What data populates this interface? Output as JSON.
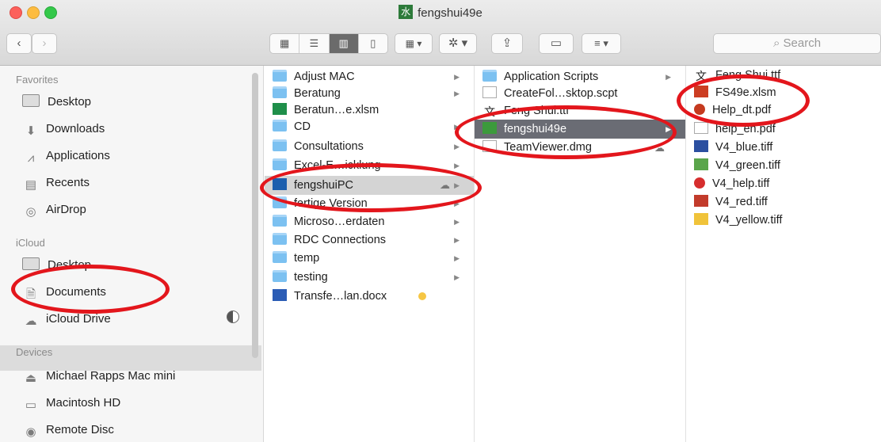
{
  "window": {
    "title": "fengshui49e"
  },
  "toolbar": {
    "back_label": "‹",
    "forward_label": "›",
    "search_placeholder": "Search"
  },
  "sidebar": {
    "favorites_header": "Favorites",
    "favorites": [
      "Desktop",
      "Downloads",
      "Applications",
      "Recents",
      "AirDrop"
    ],
    "icloud_header": "iCloud",
    "icloud": [
      "Desktop",
      "Documents",
      "iCloud Drive"
    ],
    "devices_header": "Devices",
    "devices": [
      "Michael Rapps Mac mini",
      "Macintosh HD",
      "Remote Disc"
    ]
  },
  "column1": [
    "Adjust MAC",
    "Beratung",
    "Beratun…e.xlsm",
    "CD",
    "Consultations",
    "Excel-E…icklung",
    "fengshuiPC",
    "fertige Version",
    "Microso…erdaten",
    "RDC Connections",
    "temp",
    "testing",
    "Transfe…lan.docx"
  ],
  "column2": [
    "Application Scripts",
    "CreateFol…sktop.scpt",
    "Feng Shui.ttf",
    "fengshui49e",
    "TeamViewer.dmg"
  ],
  "column3": [
    "Feng Shui.ttf",
    "FS49e.xlsm",
    "Help_dt.pdf",
    "help_en.pdf",
    "V4_blue.tiff",
    "V4_green.tiff",
    "V4_help.tiff",
    "V4_red.tiff",
    "V4_yellow.tiff"
  ],
  "colors": {
    "annotation": "#e3161c",
    "folder": "#7cc1f1",
    "selection_dark": "#6a6c74"
  }
}
